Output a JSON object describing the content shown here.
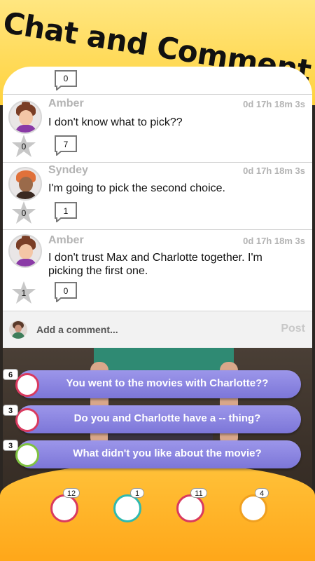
{
  "headline": "Chat and Comment",
  "partial_comment": {
    "reply_count": "0"
  },
  "comments": [
    {
      "name": "Amber",
      "time": "0d 17h 18m 3s",
      "text": "I don't know what to pick??",
      "stars": "0",
      "replies": "7"
    },
    {
      "name": "Syndey",
      "time": "0d 17h 18m 3s",
      "text": "I'm going to pick the second choice.",
      "stars": "0",
      "replies": "1"
    },
    {
      "name": "Amber",
      "time": "0d 17h 18m 3s",
      "text": "I don't trust Max and Charlotte together. I'm picking the first one.",
      "stars": "1",
      "replies": "0"
    }
  ],
  "add_comment": {
    "placeholder": "Add a comment...",
    "post_label": "Post"
  },
  "choices": [
    {
      "count": "6",
      "label": "You went to the movies with Charlotte??",
      "badge_color": "#d93a5f"
    },
    {
      "count": "3",
      "label": "Do you and Charlotte have a -- thing?",
      "badge_color": "#d93a5f"
    },
    {
      "count": "3",
      "label": "What didn't you like about the movie?",
      "badge_color": "#7fc241"
    }
  ],
  "bottom_avatars": [
    {
      "count": "12",
      "border": "#d93a5f"
    },
    {
      "count": "1",
      "border": "#2fb9b0"
    },
    {
      "count": "11",
      "border": "#d93a5f"
    },
    {
      "count": "4",
      "border": "#f0a020"
    }
  ],
  "colors": {
    "banner": "#ffd23d",
    "choice_bg": "#8c86e2",
    "accent_orange": "#ffa719"
  }
}
